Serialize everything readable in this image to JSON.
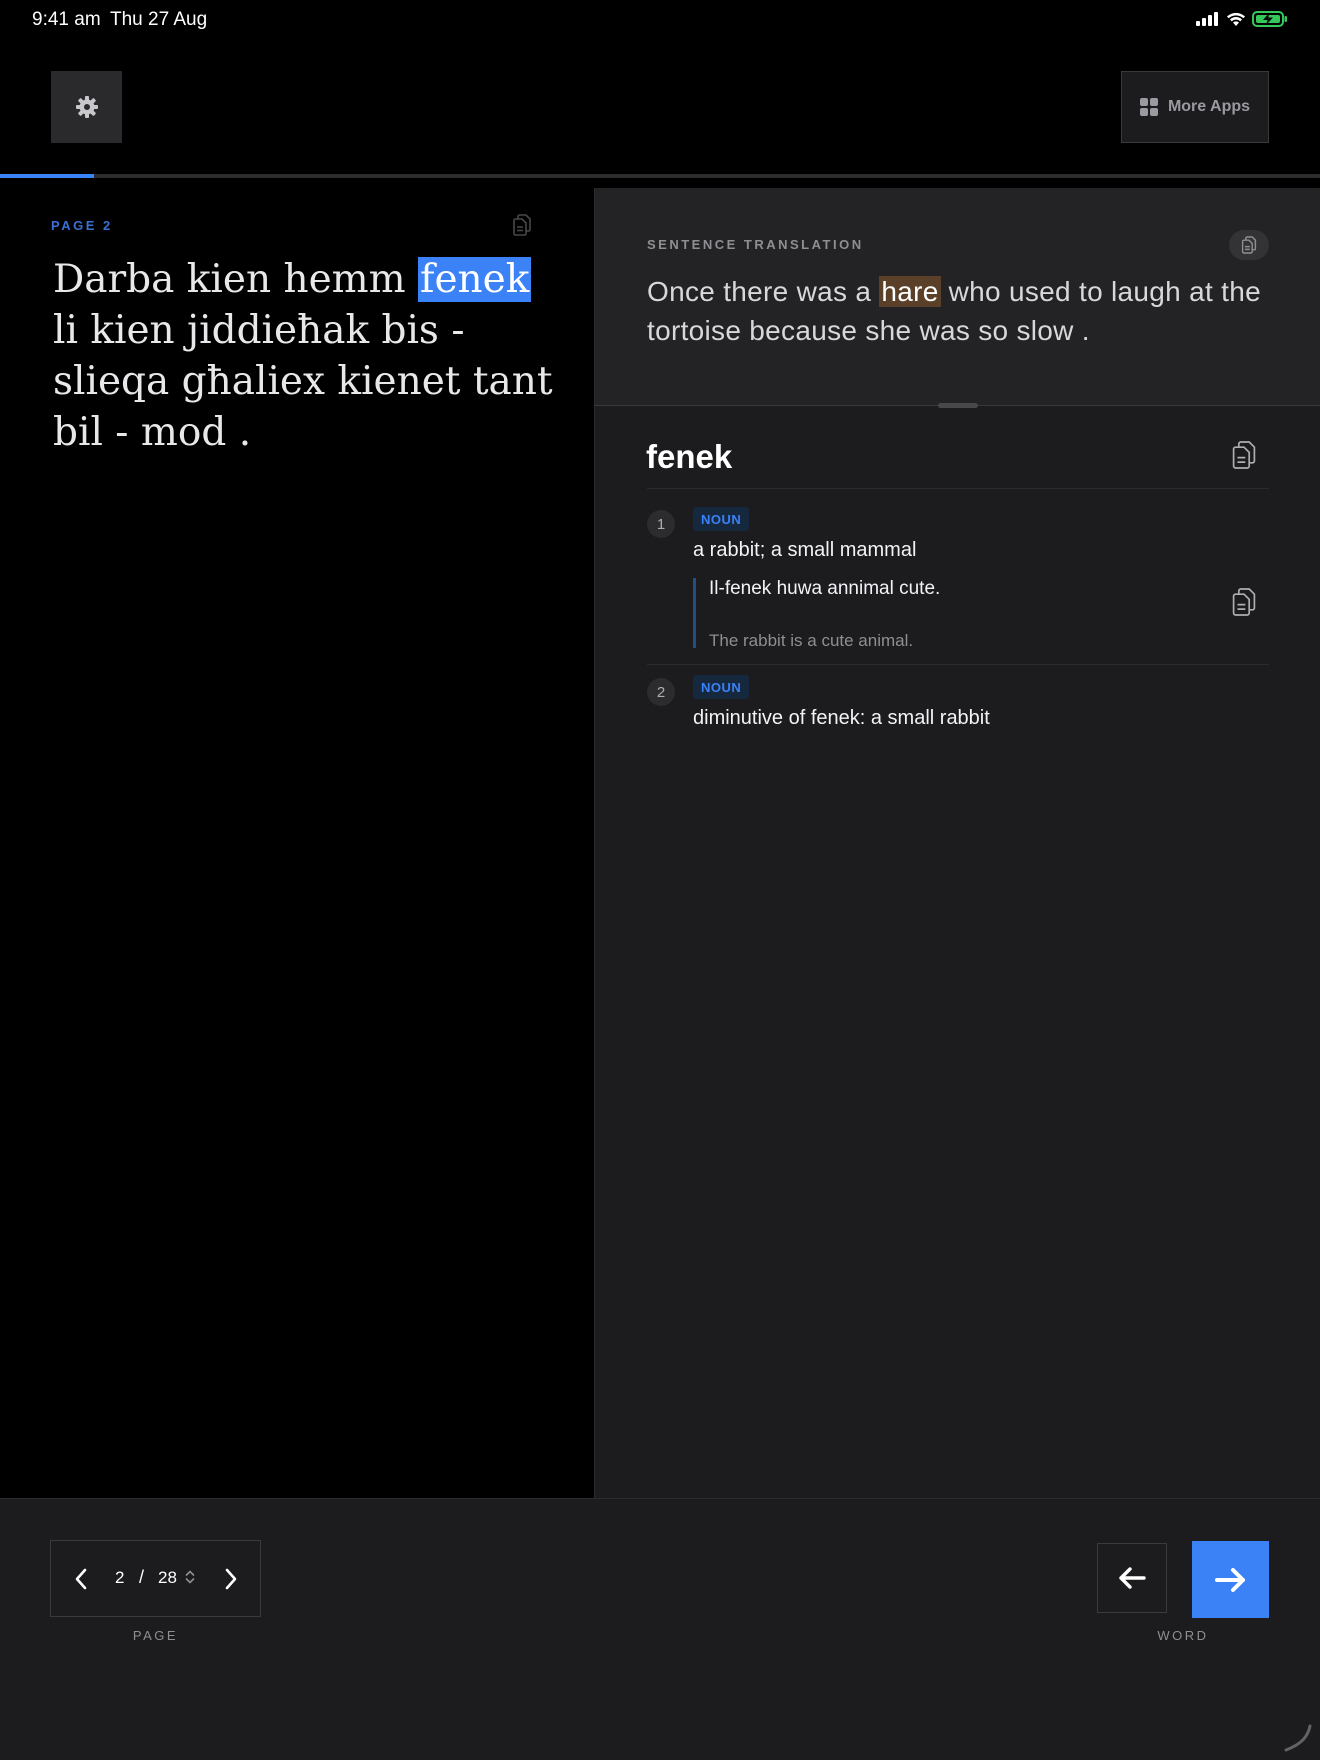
{
  "status_bar": {
    "time": "9:41 am",
    "date": "Thu 27 Aug",
    "battery_color": "#34c759"
  },
  "toolbar": {
    "settings_icon": "gear-icon",
    "more_apps_label": "More Apps",
    "more_apps_icon": "grid-icon"
  },
  "progress": {
    "fraction": 0.0714,
    "color": "#3b82f6"
  },
  "source": {
    "page_label": "PAGE  2",
    "text_before": "Darba kien hemm ",
    "highlighted_word": "fenek",
    "text_after": " li kien jiddieħak bis - slieqa għaliex kienet tant bil - mod ."
  },
  "translation": {
    "label": "SENTENCE TRANSLATION",
    "text_before": "Once there was a ",
    "highlighted_word": "hare",
    "text_after": " who used to laugh at the tortoise because she was so slow ."
  },
  "dictionary": {
    "word": "fenek",
    "senses": [
      {
        "number": "1",
        "pos": "NOUN",
        "definition": "a rabbit; a small mammal",
        "example": "Il-fenek huwa annimal cute.",
        "example_translation": "The rabbit is a cute animal."
      },
      {
        "number": "2",
        "pos": "NOUN",
        "definition": "diminutive of fenek: a small rabbit"
      }
    ]
  },
  "pager": {
    "current": "2",
    "separator": "/",
    "total": "28",
    "caption": "PAGE"
  },
  "word_nav": {
    "caption": "WORD",
    "accent": "#3b82f6"
  }
}
